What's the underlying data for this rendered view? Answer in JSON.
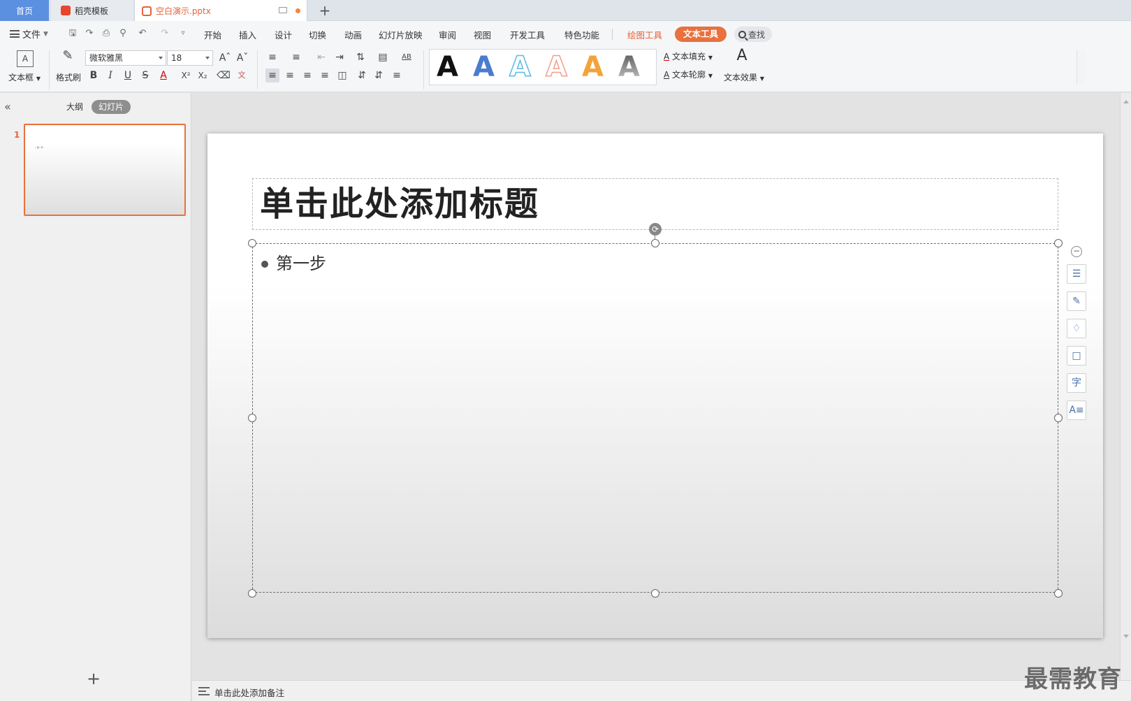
{
  "tabs": {
    "home": "首页",
    "docer": "稻壳模板",
    "document": "空白演示.pptx",
    "add": "+"
  },
  "menu": {
    "file": "文件",
    "items": [
      "开始",
      "插入",
      "设计",
      "切换",
      "动画",
      "幻灯片放映",
      "审阅",
      "视图",
      "开发工具",
      "特色功能"
    ],
    "drawing_tools": "绘图工具",
    "text_tools": "文本工具",
    "search": "查找"
  },
  "ribbon": {
    "textbox": "文本框",
    "format_painter": "格式刷",
    "font_name": "微软雅黑",
    "font_size": "18",
    "text_fill": "文本填充",
    "text_outline": "文本轮廓",
    "text_effect": "文本效果",
    "style_letter": "A"
  },
  "colors": {
    "accent": "#e8713d",
    "tab_home": "#5b8fe0",
    "gallery": [
      "#111111",
      "#4a7bd0",
      "#5bb8e6",
      "#f2a08a",
      "#f2a33a",
      "#8a8a8a"
    ]
  },
  "panel": {
    "outline_tab": "大纲",
    "slides_tab": "幻灯片",
    "slide_number": "1",
    "thumb_text": "• 第一步",
    "add": "+"
  },
  "slide": {
    "title": "单击此处添加标题",
    "bullet": "第一步"
  },
  "notes": {
    "placeholder": "单击此处添加备注"
  },
  "watermark": "最需教育",
  "side_tools": [
    "layers-icon",
    "pen-icon",
    "fill-icon",
    "border-icon",
    "font-icon",
    "text-format-icon"
  ]
}
